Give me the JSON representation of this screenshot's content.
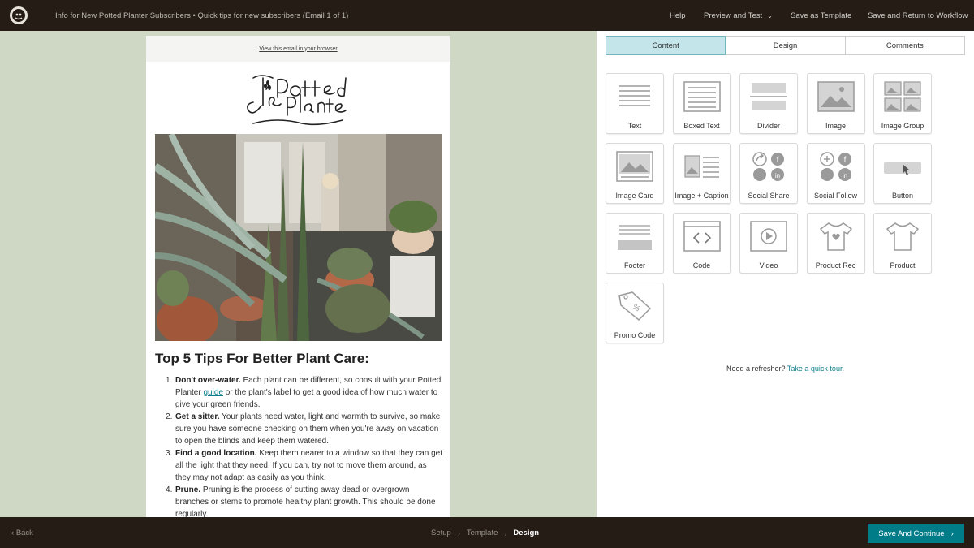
{
  "topbar": {
    "doc_title": "Info for New Potted Planter Subscribers • Quick tips for new subscribers (Email 1 of 1)",
    "help": "Help",
    "preview_test": "Preview and Test",
    "save_template": "Save as Template",
    "save_return": "Save and Return to Workflow"
  },
  "email": {
    "browser_link": "View this email in your browser",
    "heading": "Top 5 Tips For Better Plant Care:",
    "tips": [
      {
        "bold": "Don't over-water.",
        "pre": " Each plant can be different, so consult with your Potted Planter ",
        "link": "guide",
        "post": " or the plant's label to get a good idea of how much water to give your green friends."
      },
      {
        "bold": "Get a sitter.",
        "text": " Your plants need water, light and warmth to survive, so make sure you have someone checking on them when you're away on vacation to open the blinds and keep them watered."
      },
      {
        "bold": "Find a good location.",
        "text": " Keep them nearer to a window so that they can get all the light that they need. If you can, try not to move them around, as they may not adapt as easily as you think."
      },
      {
        "bold": "Prune.",
        "text": " Pruning is the process of cutting away dead or overgrown branches or stems to promote healthy plant growth. This should be done regularly."
      }
    ]
  },
  "panel": {
    "tabs": [
      "Content",
      "Design",
      "Comments"
    ],
    "blocks": [
      "Text",
      "Boxed Text",
      "Divider",
      "Image",
      "Image Group",
      "Image Card",
      "Image + Caption",
      "Social Share",
      "Social Follow",
      "Button",
      "Footer",
      "Code",
      "Video",
      "Product Rec",
      "Product",
      "Promo Code"
    ],
    "refresher_text": "Need a refresher?",
    "refresher_link": "Take a quick tour"
  },
  "bottombar": {
    "back": "Back",
    "steps": [
      "Setup",
      "Template",
      "Design"
    ],
    "save_continue": "Save And Continue"
  },
  "colors": {
    "topbar": "#241c15",
    "canvas": "#cfd8c5",
    "accent": "#007c89",
    "active_tab": "#c4e5ea"
  }
}
